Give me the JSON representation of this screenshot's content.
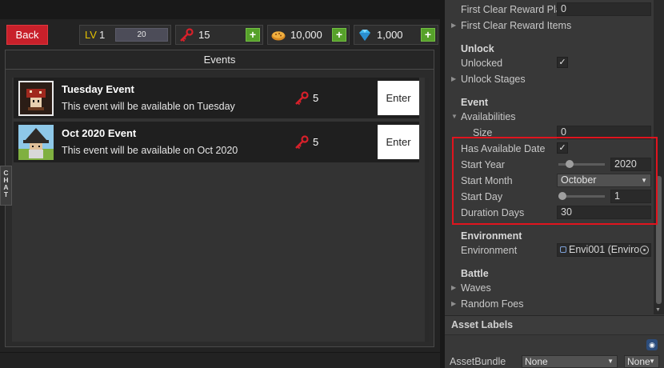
{
  "game": {
    "back_label": "Back",
    "level": {
      "label": "LV",
      "value": "1",
      "bar_value": "20"
    },
    "resources": [
      {
        "icon": "key-icon",
        "value": "15",
        "plus": "+"
      },
      {
        "icon": "pie-coin-icon",
        "value": "10,000",
        "plus": "+"
      },
      {
        "icon": "diamond-icon",
        "value": "1,000",
        "plus": "+"
      }
    ],
    "panel_title": "Events",
    "events": [
      {
        "title": "Tuesday Event",
        "description": "This event will be available on Tuesday",
        "cost": "5",
        "button": "Enter"
      },
      {
        "title": "Oct 2020 Event",
        "description": "This event will be available on Oct 2020",
        "cost": "5",
        "button": "Enter"
      }
    ],
    "chat_label": "CHAT"
  },
  "inspector": {
    "first_clear_reward_label": "First Clear Reward Pla",
    "first_clear_reward_value": "0",
    "first_clear_reward_items": "First Clear Reward Items",
    "unlock_header": "Unlock",
    "unlocked_label": "Unlocked",
    "unlocked_checked": "✓",
    "unlock_stages": "Unlock Stages",
    "event_header": "Event",
    "availabilities": "Availabilities",
    "size_label": "Size",
    "size_value": "0",
    "has_available_date_label": "Has Available Date",
    "has_available_date_checked": "✓",
    "start_year_label": "Start Year",
    "start_year_value": "2020",
    "start_month_label": "Start Month",
    "start_month_value": "October",
    "start_day_label": "Start Day",
    "start_day_value": "1",
    "duration_days_label": "Duration Days",
    "duration_days_value": "30",
    "environment_header": "Environment",
    "environment_label": "Environment",
    "environment_value": "Envi001 (Enviro",
    "battle_header": "Battle",
    "waves": "Waves",
    "random_foes": "Random Foes",
    "asset_labels_header": "Asset Labels",
    "asset_bundle_label": "AssetBundle",
    "asset_bundle_value": "None",
    "asset_bundle_variant": "None"
  },
  "colors": {
    "back_button": "#c8202a",
    "plus_button": "#56a12a",
    "highlight_box": "#e0141e",
    "level_label": "#e6c200",
    "key_icon": "#d8202a"
  }
}
